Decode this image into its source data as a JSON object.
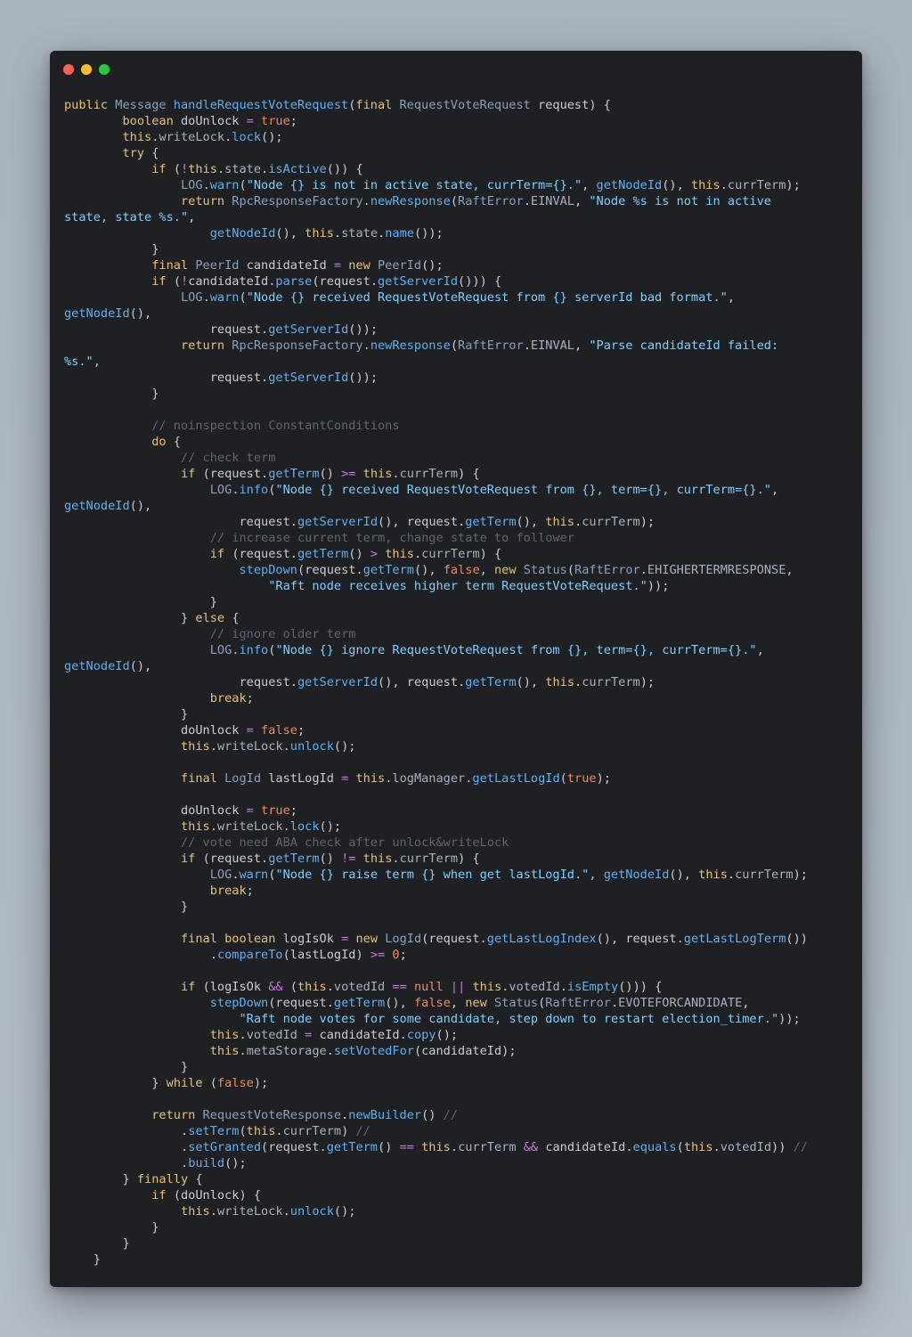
{
  "window": {
    "controls": {
      "close_color": "#ff5f56",
      "minimize_color": "#ffbd2e",
      "zoom_color": "#27c93f"
    }
  },
  "theme": {
    "background": "#1f2024",
    "keyword": "#e5c07b",
    "string": "#7dcfff",
    "literal": "#ef8a5a",
    "comment": "#5f656f"
  },
  "code_lines": [
    "public Message handleRequestVoteRequest(final RequestVoteRequest request) {",
    "        boolean doUnlock = true;",
    "        this.writeLock.lock();",
    "        try {",
    "            if (!this.state.isActive()) {",
    "                LOG.warn(\"Node {} is not in active state, currTerm={}.\", getNodeId(), this.currTerm);",
    "                return RpcResponseFactory.newResponse(RaftError.EINVAL, \"Node %s is not in active",
    "state, state %s.\",",
    "                    getNodeId(), this.state.name());",
    "            }",
    "            final PeerId candidateId = new PeerId();",
    "            if (!candidateId.parse(request.getServerId())) {",
    "                LOG.warn(\"Node {} received RequestVoteRequest from {} serverId bad format.\",",
    "getNodeId(),",
    "                    request.getServerId());",
    "                return RpcResponseFactory.newResponse(RaftError.EINVAL, \"Parse candidateId failed:",
    "%s.\",",
    "                    request.getServerId());",
    "            }",
    "",
    "            // noinspection ConstantConditions",
    "            do {",
    "                // check term",
    "                if (request.getTerm() >= this.currTerm) {",
    "                    LOG.info(\"Node {} received RequestVoteRequest from {}, term={}, currTerm={}.\",",
    "getNodeId(),",
    "                        request.getServerId(), request.getTerm(), this.currTerm);",
    "                    // increase current term, change state to follower",
    "                    if (request.getTerm() > this.currTerm) {",
    "                        stepDown(request.getTerm(), false, new Status(RaftError.EHIGHERTERMRESPONSE,",
    "                            \"Raft node receives higher term RequestVoteRequest.\"));",
    "                    }",
    "                } else {",
    "                    // ignore older term",
    "                    LOG.info(\"Node {} ignore RequestVoteRequest from {}, term={}, currTerm={}.\",",
    "getNodeId(),",
    "                        request.getServerId(), request.getTerm(), this.currTerm);",
    "                    break;",
    "                }",
    "                doUnlock = false;",
    "                this.writeLock.unlock();",
    "",
    "                final LogId lastLogId = this.logManager.getLastLogId(true);",
    "",
    "                doUnlock = true;",
    "                this.writeLock.lock();",
    "                // vote need ABA check after unlock&writeLock",
    "                if (request.getTerm() != this.currTerm) {",
    "                    LOG.warn(\"Node {} raise term {} when get lastLogId.\", getNodeId(), this.currTerm);",
    "                    break;",
    "                }",
    "",
    "                final boolean logIsOk = new LogId(request.getLastLogIndex(), request.getLastLogTerm())",
    "                    .compareTo(lastLogId) >= 0;",
    "",
    "                if (logIsOk && (this.votedId == null || this.votedId.isEmpty())) {",
    "                    stepDown(request.getTerm(), false, new Status(RaftError.EVOTEFORCANDIDATE,",
    "                        \"Raft node votes for some candidate, step down to restart election_timer.\"));",
    "                    this.votedId = candidateId.copy();",
    "                    this.metaStorage.setVotedFor(candidateId);",
    "                }",
    "            } while (false);",
    "",
    "            return RequestVoteResponse.newBuilder() //",
    "                .setTerm(this.currTerm) //",
    "                .setGranted(request.getTerm() == this.currTerm && candidateId.equals(this.votedId)) //",
    "                .build();",
    "        } finally {",
    "            if (doUnlock) {",
    "                this.writeLock.unlock();",
    "            }",
    "        }",
    "    }"
  ]
}
